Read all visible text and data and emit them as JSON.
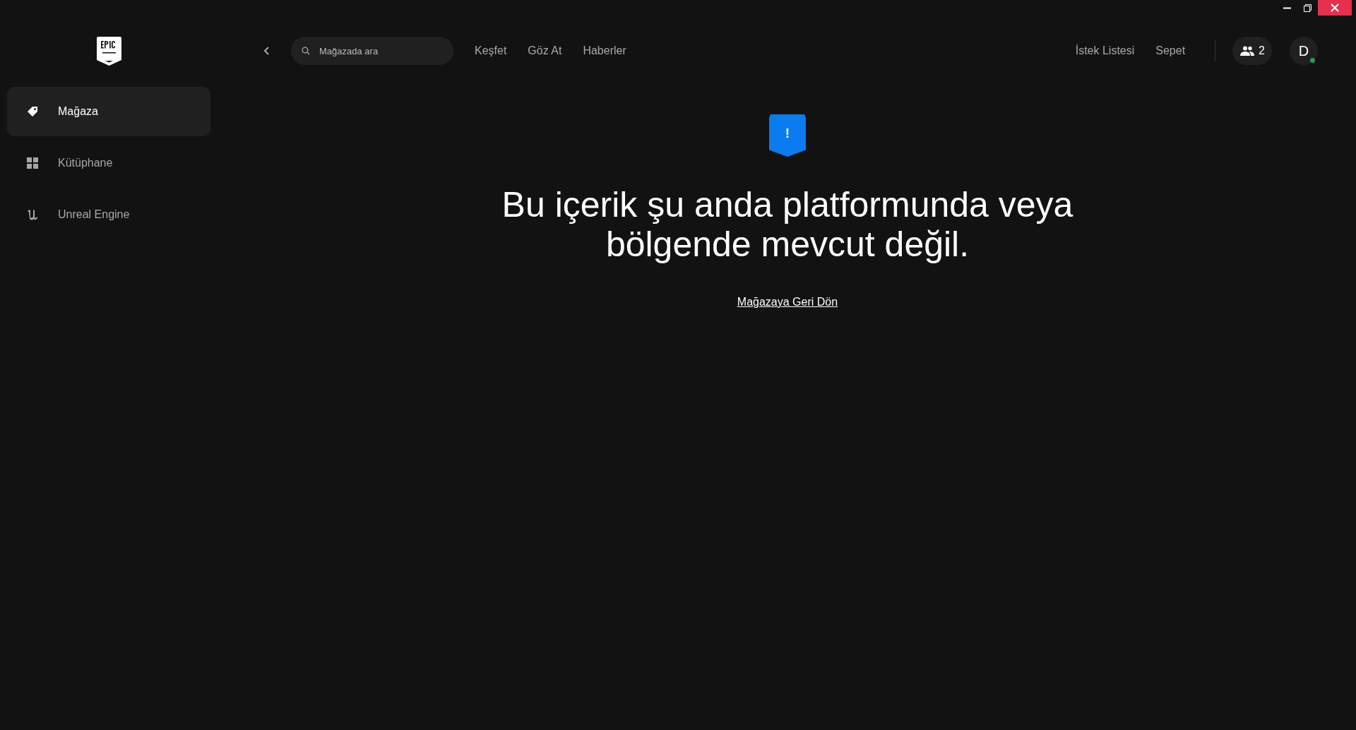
{
  "sidebar": {
    "items": [
      {
        "label": "Mağaza",
        "selected": true
      },
      {
        "label": "Kütüphane",
        "selected": false
      },
      {
        "label": "Unreal Engine",
        "selected": false
      }
    ]
  },
  "topbar": {
    "search": {
      "placeholder": "Mağazada ara"
    },
    "nav": [
      "Keşfet",
      "Göz At",
      "Haberler"
    ],
    "right_links": [
      "İstek Listesi",
      "Sepet"
    ],
    "friends": {
      "count": "2"
    },
    "avatar": {
      "initial": "D",
      "online": true
    }
  },
  "message": {
    "badge": "!",
    "heading": "Bu içerik şu anda platformunda veya bölgende mevcut değil.",
    "link": "Mağazaya Geri Dön"
  }
}
